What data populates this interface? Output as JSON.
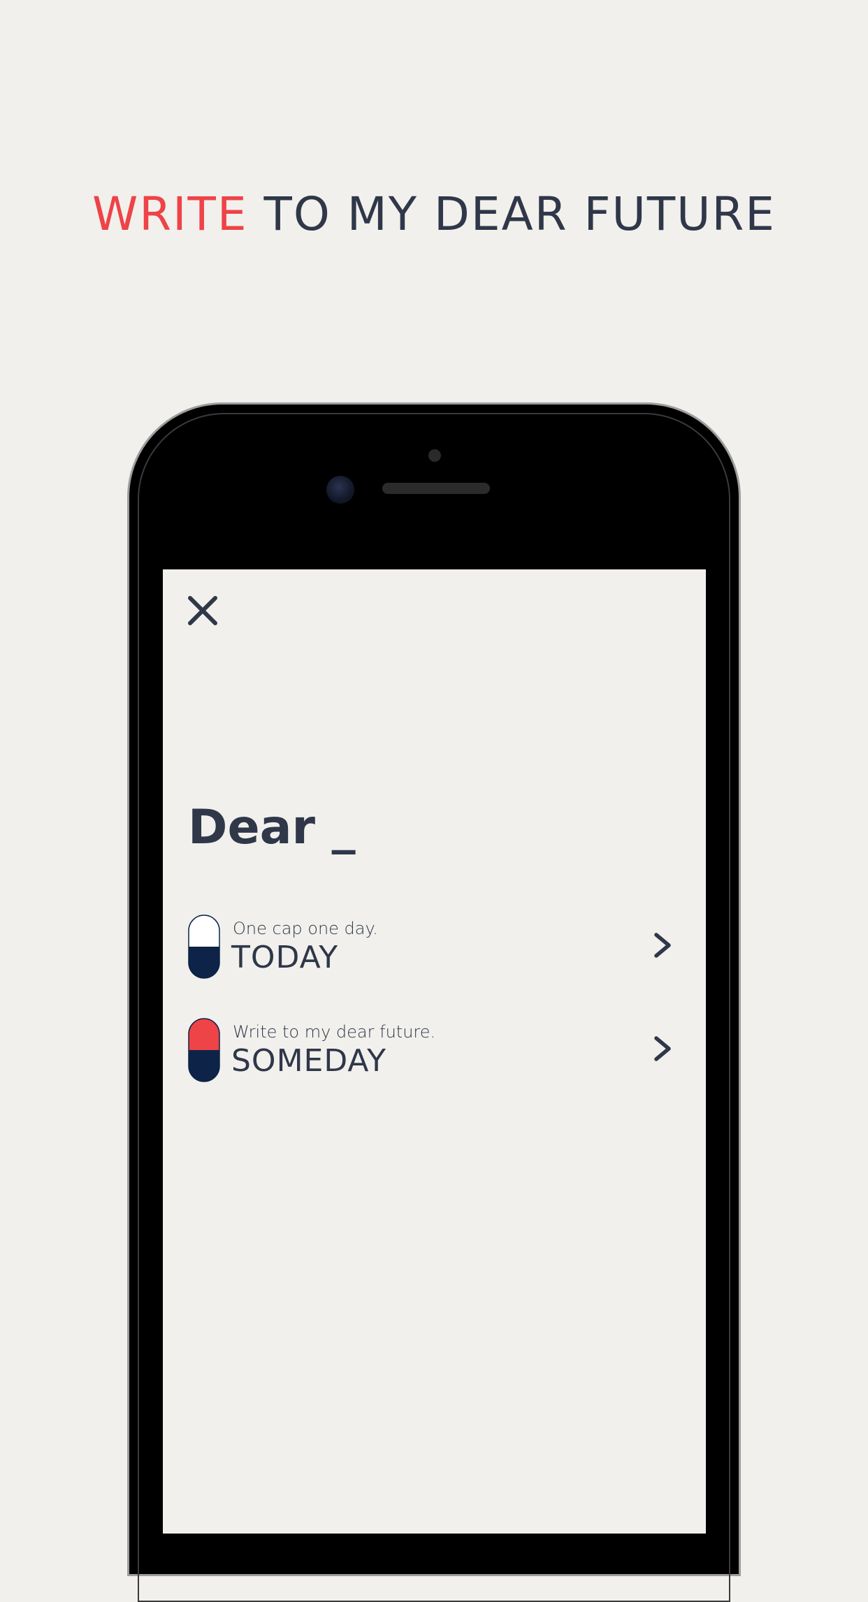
{
  "headline": {
    "accent_word": "WRITE",
    "rest": " TO MY DEAR FUTURE",
    "accent_color": "#ee4347",
    "text_color": "#2f3749"
  },
  "screen": {
    "close_icon": "close-icon",
    "title": "Dear _",
    "options": [
      {
        "subtitle": "One cap one day.",
        "label": "TODAY",
        "pill_top_color": "#ffffff",
        "pill_bottom_color": "#0d2347",
        "chevron_icon": "chevron-right-icon"
      },
      {
        "subtitle": "Write to my dear future.",
        "label": "SOMEDAY",
        "pill_top_color": "#ee4347",
        "pill_bottom_color": "#0d2347",
        "chevron_icon": "chevron-right-icon"
      }
    ]
  }
}
